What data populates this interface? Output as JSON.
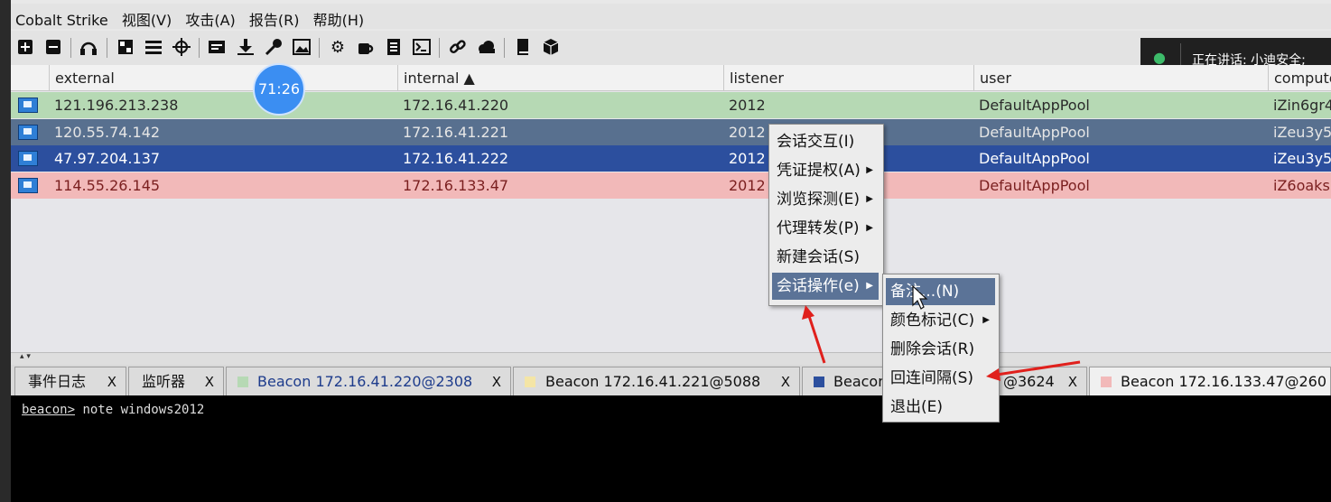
{
  "menubar": [
    "Cobalt Strike",
    "视图(V)",
    "攻击(A)",
    "报告(R)",
    "帮助(H)"
  ],
  "toolbar_icons": [
    "plus-box-icon",
    "minus-box-icon",
    "headphones-icon",
    "grid-icon",
    "list-icon",
    "crosshair-icon",
    "image-icon",
    "download-icon",
    "key-icon",
    "picture-icon",
    "gear-icon",
    "coffee-icon",
    "document-icon",
    "terminal-icon",
    "link-icon",
    "cloud-icon",
    "book-icon",
    "cube-icon"
  ],
  "overlay": {
    "speaking": "正在讲话: 小迪安全;"
  },
  "timer": "71:26",
  "table": {
    "columns": [
      "external",
      "internal ▲",
      "listener",
      "user",
      "compute"
    ],
    "rows": [
      {
        "external": "121.196.213.238",
        "internal": "172.16.41.220",
        "listener": "2012",
        "user": "DefaultAppPool",
        "computer": "iZin6gr4",
        "bg": "#b6d9b4",
        "fg": "#2a2a2a"
      },
      {
        "external": "120.55.74.142",
        "internal": "172.16.41.221",
        "listener": "2012",
        "user": "DefaultAppPool",
        "computer": "iZeu3y5",
        "bg": "#58708f",
        "fg": "#e6e6e6"
      },
      {
        "external": "47.97.204.137",
        "internal": "172.16.41.222",
        "listener": "2012",
        "user": "DefaultAppPool",
        "computer": "iZeu3y5",
        "bg": "#2c4f9e",
        "fg": "#ffffff"
      },
      {
        "external": "114.55.26.145",
        "internal": "172.16.133.47",
        "listener": "2012",
        "user": "DefaultAppPool",
        "computer": "iZ6oaks",
        "bg": "#f2b9b9",
        "fg": "#7a1f1f"
      }
    ]
  },
  "tabs": [
    {
      "label": "事件日志",
      "close": "X",
      "swatch": ""
    },
    {
      "label": "监听器",
      "close": "X",
      "swatch": ""
    },
    {
      "label": "Beacon 172.16.41.220@2308",
      "close": "X",
      "swatch": "#b6d9b4"
    },
    {
      "label": "Beacon 172.16.41.221@5088",
      "close": "X",
      "swatch": "#f4e5a6"
    },
    {
      "label": "Beacon",
      "close": "X",
      "swatch": "#2c4f9e"
    },
    {
      "label": "@3624",
      "close": "X",
      "swatch": ""
    },
    {
      "label": "Beacon 172.16.133.47@260",
      "close": "",
      "swatch": "#f2b9b9"
    }
  ],
  "console": {
    "prompt": "beacon>",
    "command": " note windows2012"
  },
  "context_menu": {
    "items": [
      {
        "label": "会话交互(I)",
        "submenu": false
      },
      {
        "label": "凭证提权(A)",
        "submenu": true
      },
      {
        "label": "浏览探测(E)",
        "submenu": true
      },
      {
        "label": "代理转发(P)",
        "submenu": true
      },
      {
        "label": "新建会话(S)",
        "submenu": false
      },
      {
        "label": "会话操作(e)",
        "submenu": true
      }
    ]
  },
  "sub_menu": {
    "items": [
      {
        "label": "备注...(N)",
        "submenu": false
      },
      {
        "label": "颜色标记(C)",
        "submenu": true
      },
      {
        "label": "删除会话(R)",
        "submenu": false
      },
      {
        "label": "回连间隔(S)",
        "submenu": false
      },
      {
        "label": "退出(E)",
        "submenu": false
      }
    ]
  },
  "colors": {
    "annotation_arrow": "#e0201c",
    "menu_highlight": "#5b7397"
  }
}
